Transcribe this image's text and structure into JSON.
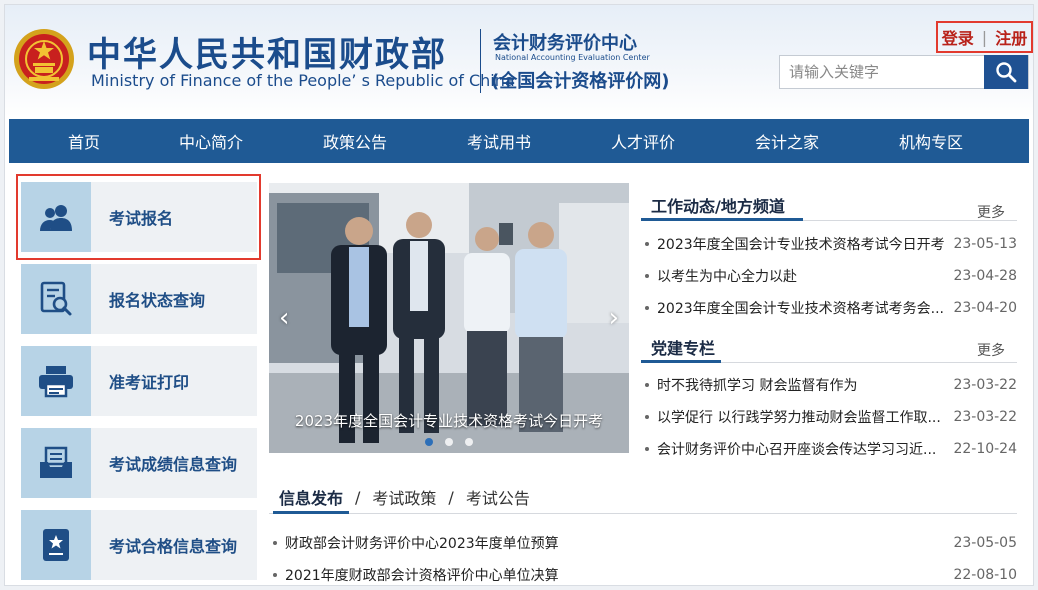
{
  "header": {
    "org_cn": "中华人民共和国财政部",
    "org_en": "Ministry of Finance of the People’ s Republic of China",
    "center_cn": "会计财务评价中心",
    "center_en": "National Accounting Evaluation Center",
    "center_net": "(全国会计资格评价网)"
  },
  "auth": {
    "login": "登录",
    "separator": "|",
    "register": "注册"
  },
  "search": {
    "placeholder": "请输入关键字"
  },
  "nav": [
    "首页",
    "中心简介",
    "政策公告",
    "考试用书",
    "人才评价",
    "会计之家",
    "机构专区"
  ],
  "sidebar": [
    {
      "label": "考试报名",
      "icon": "users-icon"
    },
    {
      "label": "报名状态查询",
      "icon": "document-search-icon"
    },
    {
      "label": "准考证打印",
      "icon": "printer-icon"
    },
    {
      "label": "考试成绩信息查询",
      "icon": "inbox-icon"
    },
    {
      "label": "考试合格信息查询",
      "icon": "certificate-icon"
    }
  ],
  "banner": {
    "caption": "2023年度全国会计专业技术资格考试今日开考",
    "slide_count": 3,
    "active_slide": 1
  },
  "work_news": {
    "title": "工作动态/地方频道",
    "more": "更多",
    "items": [
      {
        "title": "2023年度全国会计专业技术资格考试今日开考",
        "date": "23-05-13"
      },
      {
        "title": "以考生为中心全力以赴",
        "date": "23-04-28"
      },
      {
        "title": "2023年度全国会计专业技术资格考试考务会...",
        "date": "23-04-20"
      }
    ]
  },
  "party": {
    "title": "党建专栏",
    "more": "更多",
    "items": [
      {
        "title": "时不我待抓学习 财会监督有作为",
        "date": "23-03-22"
      },
      {
        "title": "以学促行  以行践学努力推动财会监督工作取...",
        "date": "23-03-22"
      },
      {
        "title": "会计财务评价中心召开座谈会传达学习习近...",
        "date": "22-10-24"
      }
    ]
  },
  "info": {
    "tabs": [
      "信息发布",
      "考试政策",
      "考试公告"
    ],
    "tab_separator": "/",
    "items": [
      {
        "title": "财政部会计财务评价中心2023年度单位预算",
        "date": "23-05-05"
      },
      {
        "title": "2021年度财政部会计资格评价中心单位决算",
        "date": "22-08-10"
      }
    ]
  },
  "colors": {
    "primary": "#1f5a95",
    "highlight": "#e23a2e",
    "sidebar_icon_bg": "#b7d3e6"
  }
}
